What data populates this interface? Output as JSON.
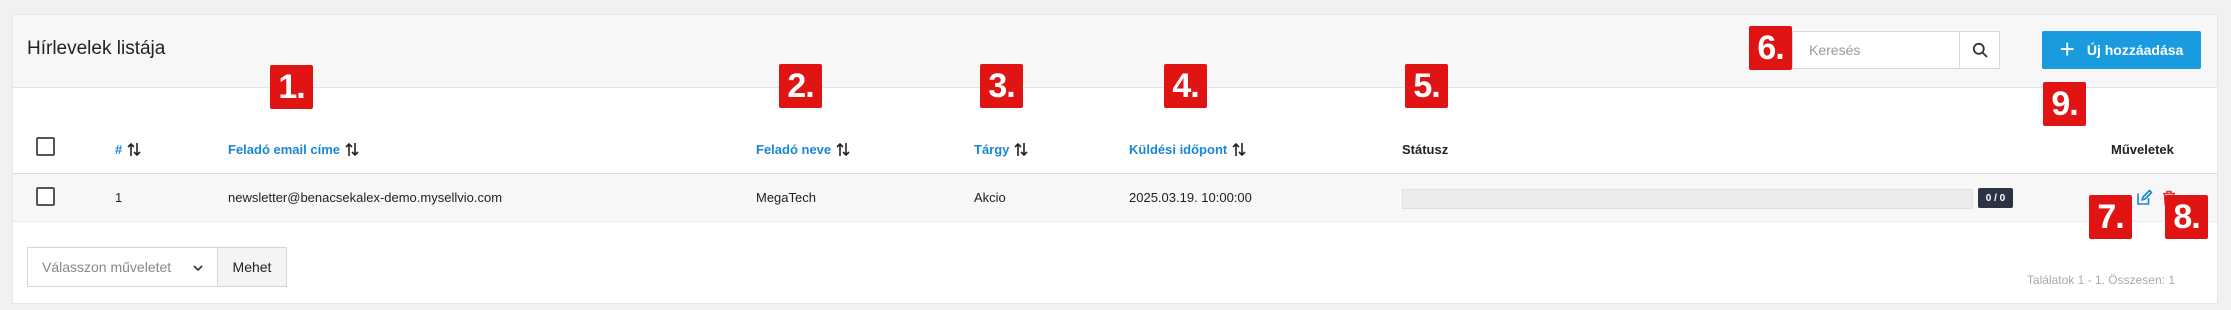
{
  "header": {
    "title": "Hírlevelek listája",
    "search_placeholder": "Keresés",
    "search_icon": "search-icon",
    "add_label": "Új hozzáadása",
    "add_icon": "plus-icon"
  },
  "table": {
    "columns": {
      "id": "#",
      "sender_email": "Feladó email címe",
      "sender_name": "Feladó neve",
      "subject": "Tárgy",
      "send_time": "Küldési időpont",
      "status": "Státusz",
      "actions": "Műveletek"
    },
    "rows": [
      {
        "id": "1",
        "sender_email": "newsletter@benacsekalex-demo.mysellvio.com",
        "sender_name": "MegaTech",
        "subject": "Akcio",
        "send_time": "2025.03.19. 10:00:00",
        "progress": 0,
        "counter": "0 / 0"
      }
    ]
  },
  "footer": {
    "bulk_select_placeholder": "Válasszon műveletet",
    "go_label": "Mehet",
    "results_text": "Találatok 1 - 1. Összesen: 1"
  },
  "markers": [
    "1.",
    "2.",
    "3.",
    "4.",
    "5.",
    "6.",
    "7.",
    "8.",
    "9."
  ],
  "colors": {
    "accent": "#1a9be0",
    "link": "#1a87d6",
    "marker": "#e11414",
    "delete": "#e53935",
    "badge": "#2c3345"
  }
}
